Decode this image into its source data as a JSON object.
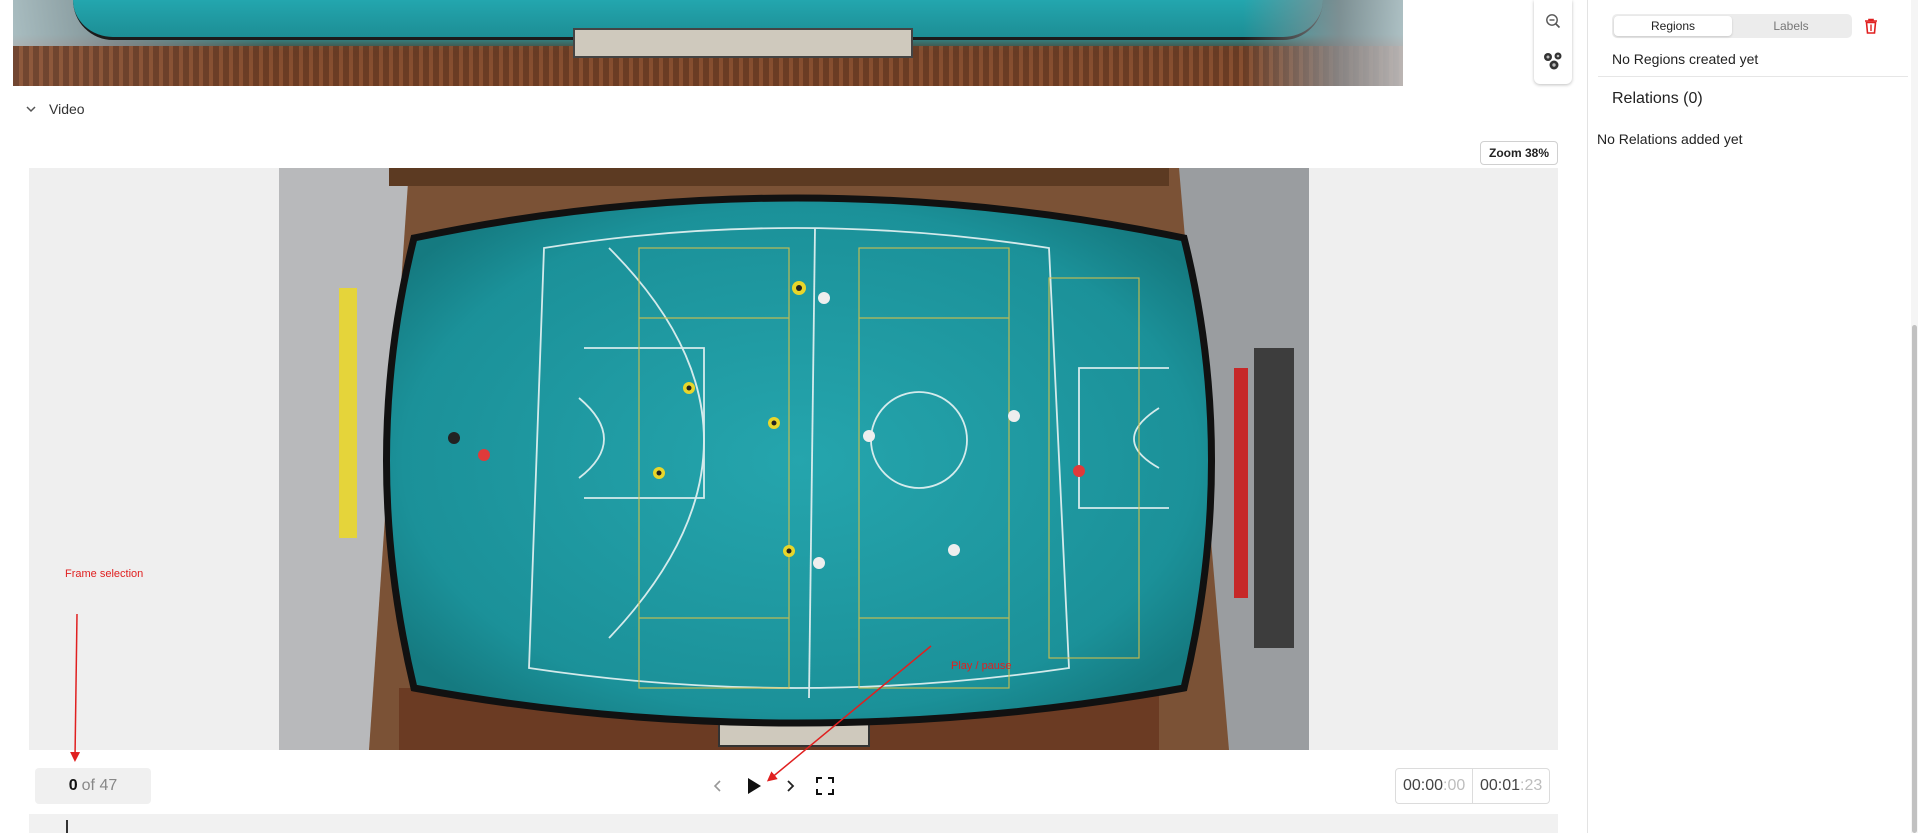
{
  "video_section": {
    "header_label": "Video",
    "zoom_label": "Zoom 38%"
  },
  "annotations": {
    "frame_selection": "Frame selection",
    "play_pause": "Play / pause",
    "color": "#e02020"
  },
  "controls": {
    "current_frame": "0",
    "of_total": "of 47",
    "time_current_main": "00:00",
    "time_current_frac": ":00",
    "time_total_main": "00:01",
    "time_total_frac": ":23"
  },
  "sidebar": {
    "tabs": [
      {
        "label": "Regions",
        "active": true
      },
      {
        "label": "Labels",
        "active": false
      }
    ],
    "no_regions_text": "No Regions created yet",
    "relations_title": "Relations (0)",
    "no_relations_text": "No Relations added yet"
  },
  "colors": {
    "court": "#1f9aa2",
    "accent_red": "#e02020"
  },
  "icons": [
    "zoom-out-icon",
    "cluster-icon",
    "chevron-down-icon",
    "prev-frame-icon",
    "play-icon",
    "next-frame-icon",
    "fullscreen-icon",
    "trash-icon"
  ]
}
